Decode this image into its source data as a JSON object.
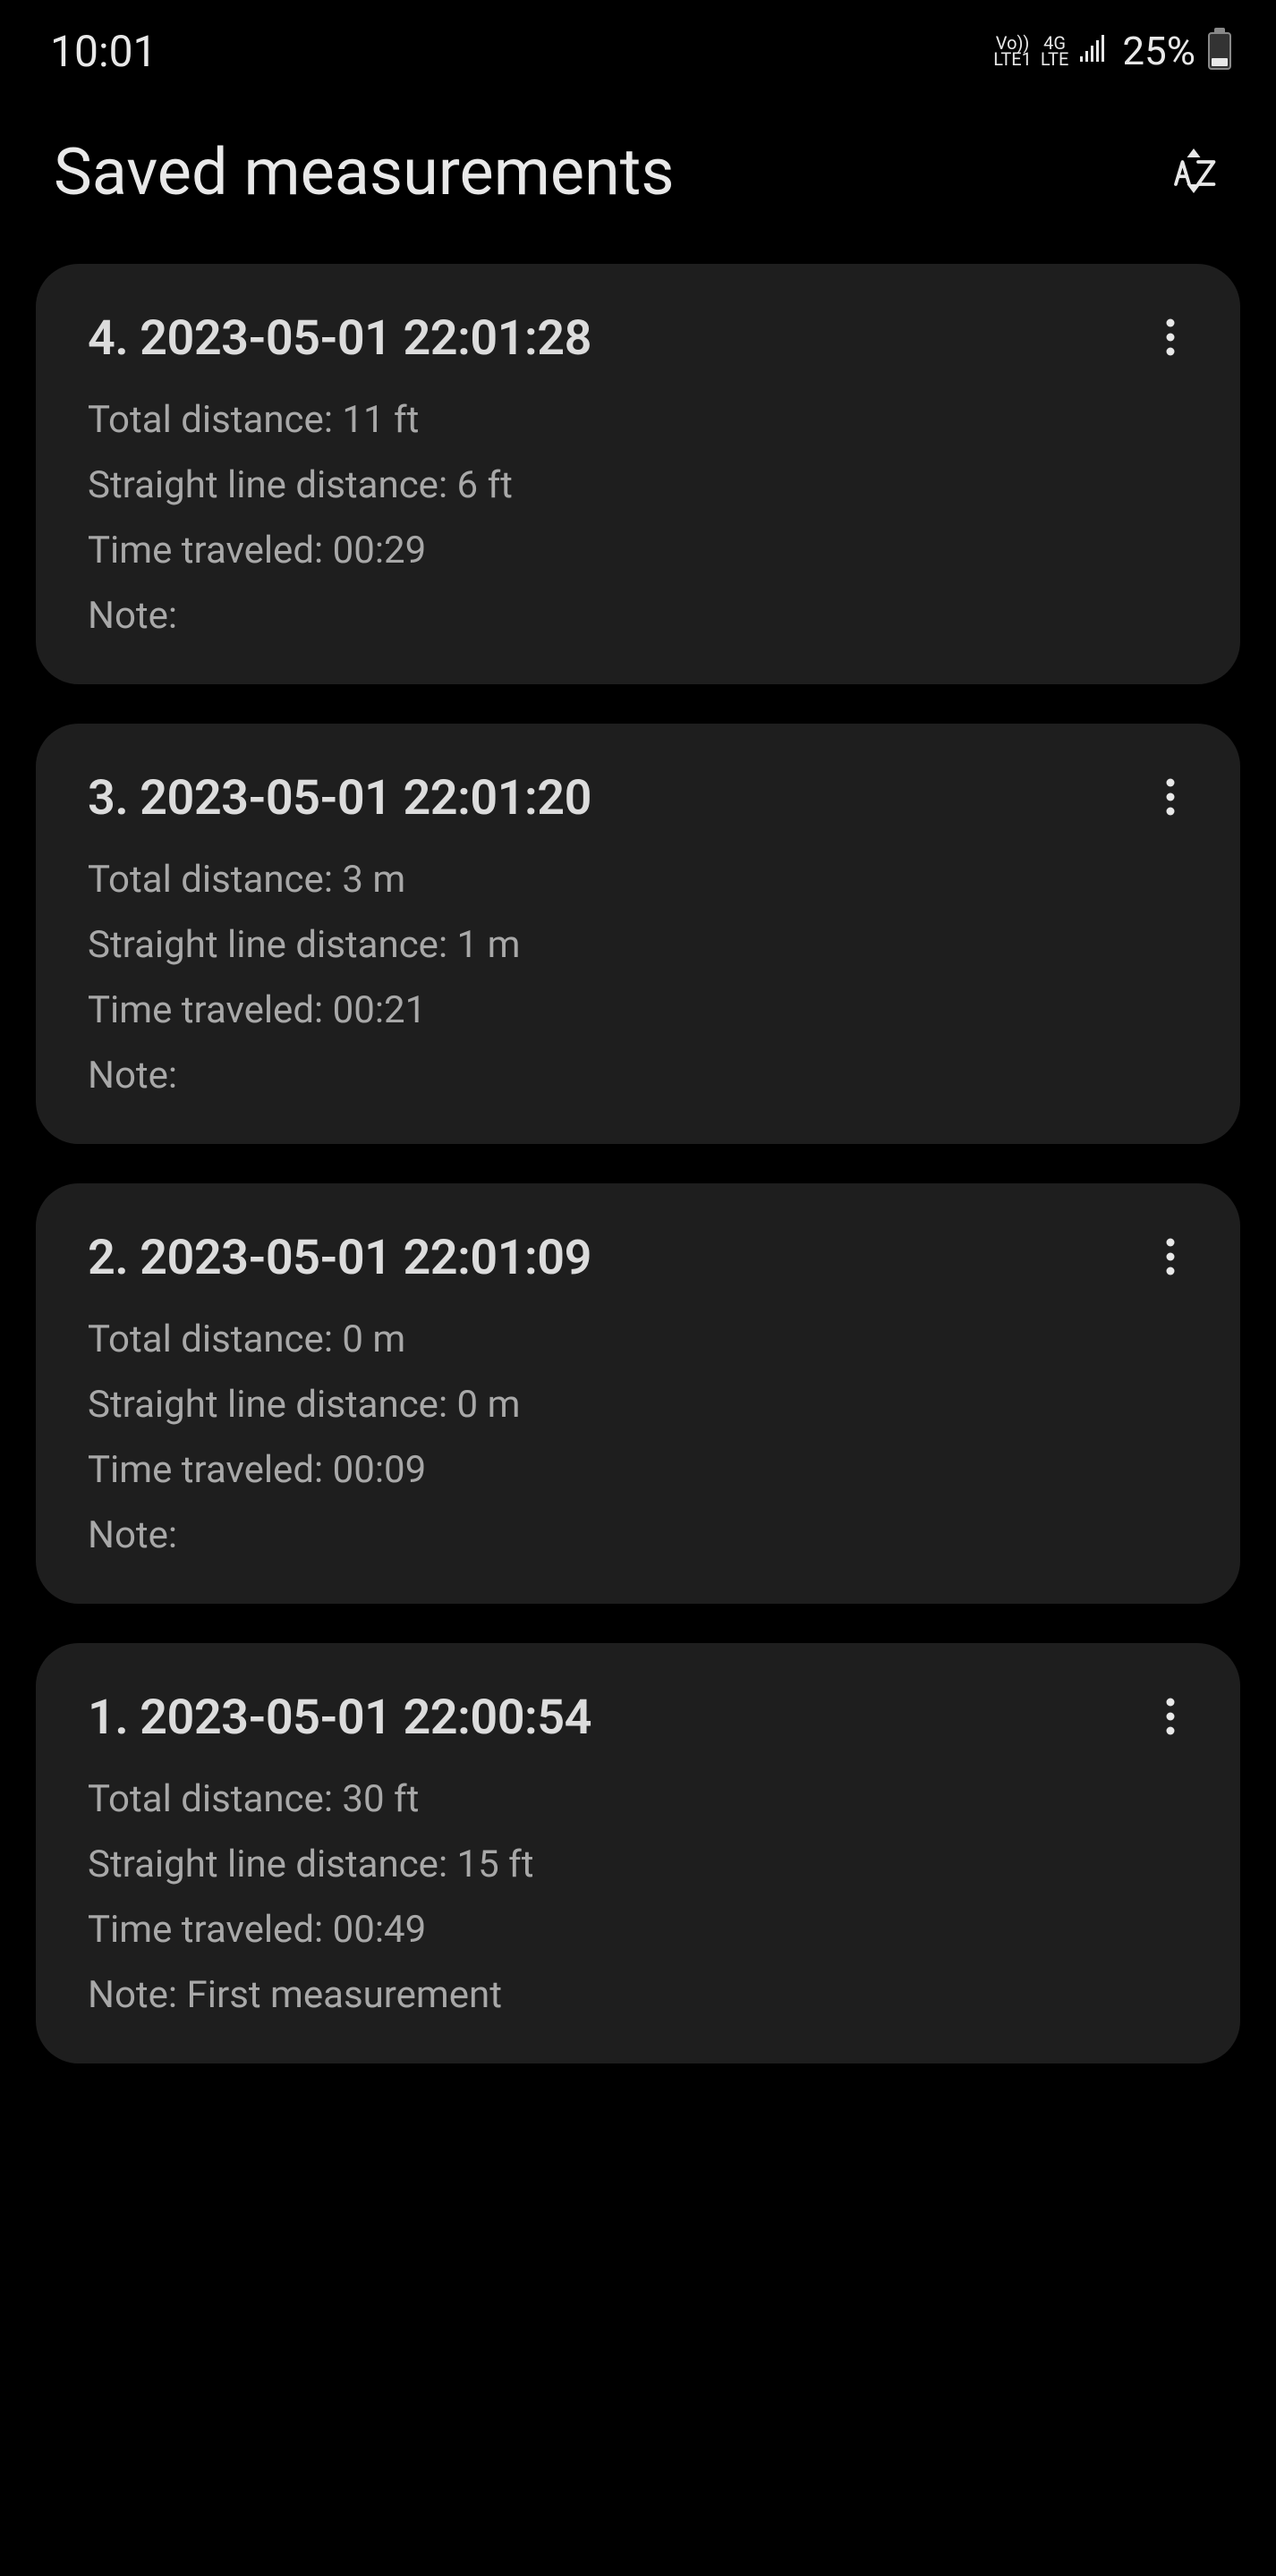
{
  "status": {
    "time": "10:01",
    "volte": "Vo))\nLTE1",
    "net": "4G\nLTE",
    "battery_pct": "25%"
  },
  "header": {
    "title": "Saved measurements"
  },
  "labels": {
    "total_distance": "Total distance: ",
    "straight_distance": "Straight line distance: ",
    "time_traveled": "Time traveled: ",
    "note": "Note: "
  },
  "items": [
    {
      "title": "4. 2023-05-01 22:01:28",
      "total_distance": "11 ft",
      "straight_distance": "6 ft",
      "time_traveled": "00:29",
      "note": ""
    },
    {
      "title": "3. 2023-05-01 22:01:20",
      "total_distance": "3 m",
      "straight_distance": "1 m",
      "time_traveled": "00:21",
      "note": ""
    },
    {
      "title": "2. 2023-05-01 22:01:09",
      "total_distance": "0 m",
      "straight_distance": "0 m",
      "time_traveled": "00:09",
      "note": ""
    },
    {
      "title": "1. 2023-05-01 22:00:54",
      "total_distance": "30 ft",
      "straight_distance": "15 ft",
      "time_traveled": "00:49",
      "note": "First measurement"
    }
  ]
}
